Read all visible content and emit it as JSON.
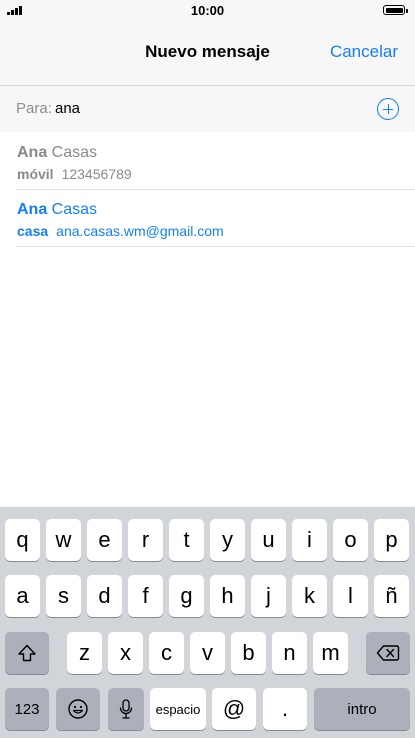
{
  "status_bar": {
    "time": "10:00"
  },
  "nav": {
    "title": "Nuevo mensaje",
    "cancel_label": "Cancelar"
  },
  "recipient": {
    "label": "Para:",
    "value": "ana"
  },
  "suggestions": [
    {
      "name_match": "Ana",
      "name_rest": " Casas",
      "detail_label": "móvil",
      "detail_value": "123456789"
    },
    {
      "name_match": "Ana",
      "name_rest": " Casas",
      "detail_label": "casa",
      "detail_value": "ana.casas.wm@gmail.com"
    }
  ],
  "keyboard": {
    "row1": [
      "q",
      "w",
      "e",
      "r",
      "t",
      "y",
      "u",
      "i",
      "o",
      "p"
    ],
    "row2": [
      "a",
      "s",
      "d",
      "f",
      "g",
      "h",
      "j",
      "k",
      "l",
      "ñ"
    ],
    "row3": [
      "z",
      "x",
      "c",
      "v",
      "b",
      "n",
      "m"
    ],
    "numbers_label": "123",
    "space_label": "espacio",
    "at_label": "@",
    "period_label": ".",
    "return_label": "intro"
  },
  "colors": {
    "accent": "#147efb",
    "keyboard_bg": "#d1d4d9",
    "dark_key": "#abb0ba"
  }
}
